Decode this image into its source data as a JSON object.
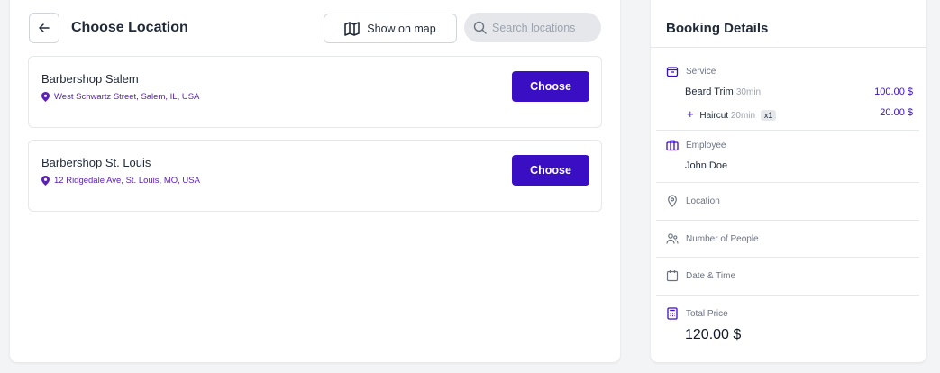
{
  "header": {
    "title": "Choose Location",
    "show_on_map_label": "Show on map",
    "search_placeholder": "Search locations"
  },
  "locations": [
    {
      "name": "Barbershop Salem",
      "address": "West Schwartz Street, Salem, IL, USA",
      "button_label": "Choose"
    },
    {
      "name": "Barbershop St. Louis",
      "address": "12 Ridgedale Ave, St. Louis, MO, USA",
      "button_label": "Choose"
    }
  ],
  "booking": {
    "title": "Booking Details",
    "service_label": "Service",
    "service_main": {
      "name": "Beard Trim",
      "duration": "30min",
      "price": "100.00 $"
    },
    "service_extra": {
      "prefix": "+",
      "name": "Haircut",
      "duration": "20min",
      "qty": "x1",
      "price": "20.00 $"
    },
    "employee_label": "Employee",
    "employee_name": "John Doe",
    "location_label": "Location",
    "people_label": "Number of People",
    "datetime_label": "Date & Time",
    "total_label": "Total Price",
    "total_value": "120.00 $"
  },
  "colors": {
    "accent": "#3a0fc4",
    "address": "#5b21b6"
  },
  "icons": [
    "back-arrow-icon",
    "map-icon",
    "search-icon",
    "location-pin-icon",
    "service-box-icon",
    "briefcase-icon",
    "location-icon",
    "people-icon",
    "calendar-icon",
    "calculator-icon"
  ]
}
